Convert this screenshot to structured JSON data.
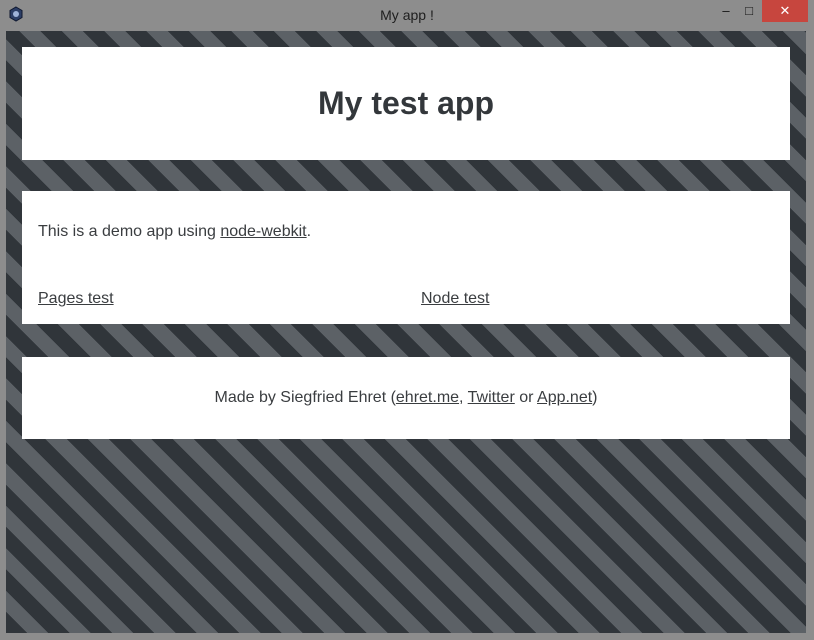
{
  "window": {
    "title": "My app !",
    "controls": {
      "minimize": "–",
      "maximize": "□",
      "close": "✕"
    },
    "icon": "app-logo-icon"
  },
  "header": {
    "title": "My test app"
  },
  "main": {
    "intro_prefix": "This is a demo app using ",
    "intro_link": "node-webkit",
    "intro_suffix": ".",
    "links": {
      "pages": "Pages test",
      "node": "Node test"
    }
  },
  "footer": {
    "prefix": "Made by Siegfried Ehret (",
    "link1": "ehret.me",
    "sep1": ", ",
    "link2": "Twitter",
    "sep2": " or ",
    "link3": "App.net",
    "suffix": ")"
  },
  "colors": {
    "stripe_dark": "#30353a",
    "stripe_light": "#5c6166",
    "card_bg": "#ffffff",
    "text": "#3a3d40",
    "close_button": "#c7463e",
    "chrome": "#8d8d8d"
  }
}
